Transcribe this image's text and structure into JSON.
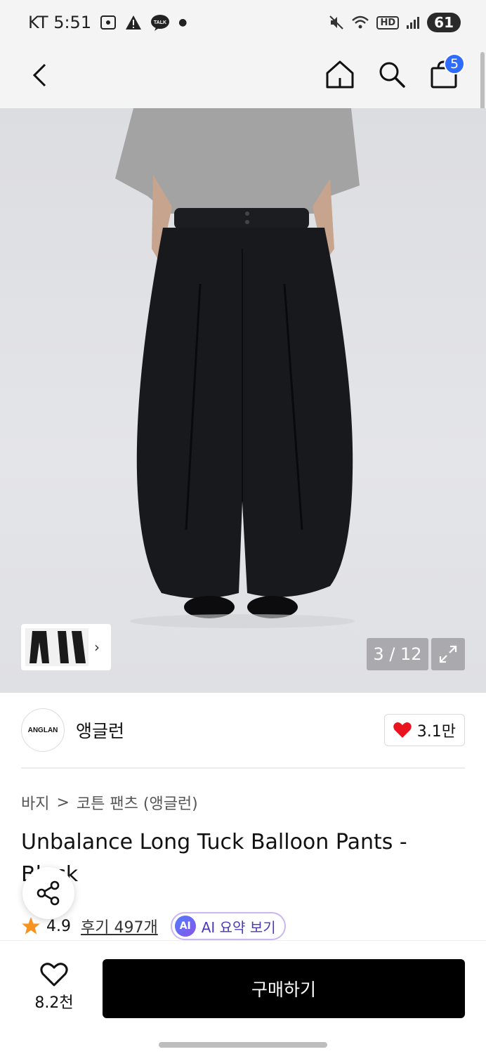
{
  "status_bar": {
    "carrier": "KT",
    "time": "5:51",
    "hd_label": "HD",
    "battery": "61",
    "talk_label": "TALK"
  },
  "nav": {
    "cart_count": "5"
  },
  "gallery": {
    "counter": "3 / 12"
  },
  "brand": {
    "logo_text": "ANGLAN",
    "name": "앵글런",
    "likes": "3.1만"
  },
  "breadcrumb": {
    "category": "바지",
    "separator": ">",
    "subcategory": "코튼 팬츠 (앵글런)"
  },
  "product": {
    "title": "Unbalance Long Tuck Balloon Pants - Black",
    "rating": "4.9",
    "reviews": "후기 497개",
    "ai_badge": "AI",
    "ai_summary": "AI 요약 보기"
  },
  "bottom": {
    "wish_count": "8.2천",
    "buy_label": "구매하기"
  },
  "colors": {
    "accent_blue": "#2f6bff",
    "heart_red": "#e8141e",
    "star_orange": "#f7931e",
    "ai_purple": "#8a54e6"
  }
}
